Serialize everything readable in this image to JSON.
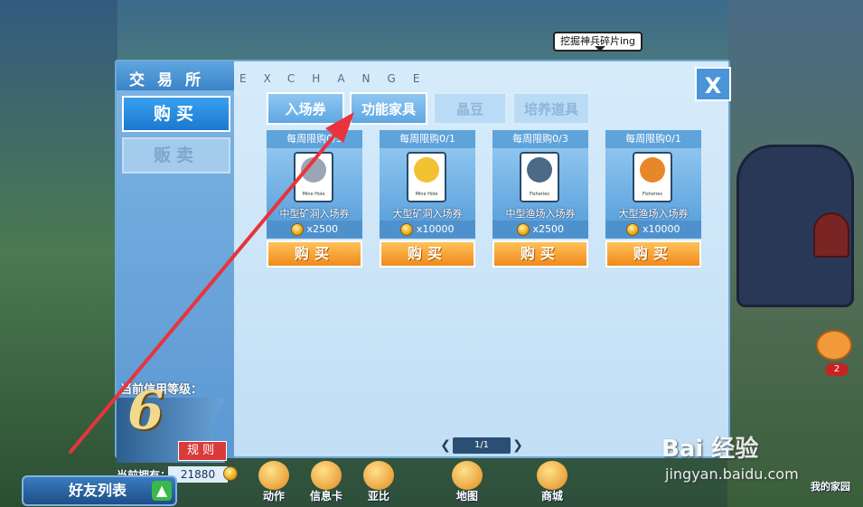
{
  "tooltip": "挖掘神兵碎片ing",
  "panel": {
    "title": "交易所",
    "subtitle": "EXCHANGE",
    "close_label": "X"
  },
  "sidebar": {
    "buy_label": "购买",
    "sell_label": "贩卖",
    "credit_label": "当前信用等级：",
    "credit_level": "6",
    "rule_label": "规则",
    "owned_label": "当前拥有：",
    "owned_value": "21880"
  },
  "tabs": [
    {
      "label": "入场券",
      "active": true
    },
    {
      "label": "功能家具",
      "active": true
    },
    {
      "label": "晶豆",
      "active": false
    },
    {
      "label": "培养道具",
      "active": false
    }
  ],
  "items": [
    {
      "limit": "每周限购0/3",
      "name": "中型矿洞入场券",
      "price": "x2500",
      "ticket_text": "Mine Hole",
      "buy_label": "购买",
      "art_color": "#9aa6b4"
    },
    {
      "limit": "每周限购0/1",
      "name": "大型矿洞入场券",
      "price": "x10000",
      "ticket_text": "Mine Hole",
      "buy_label": "购买",
      "art_color": "#f2c232"
    },
    {
      "limit": "每周限购0/3",
      "name": "中型渔场入场券",
      "price": "x2500",
      "ticket_text": "Fisheries",
      "buy_label": "购买",
      "art_color": "#4a6a86"
    },
    {
      "limit": "每周限购0/1",
      "name": "大型渔场入场券",
      "price": "x10000",
      "ticket_text": "Fisheries",
      "buy_label": "购买",
      "art_color": "#e8862a"
    }
  ],
  "pager": {
    "value": "1/1",
    "prev": "❮",
    "next": "❯"
  },
  "bottom": {
    "friends_label": "好友列表",
    "nav": [
      {
        "label": "动作"
      },
      {
        "label": "信息卡"
      },
      {
        "label": "亚比"
      },
      {
        "label": "地图"
      },
      {
        "label": "商城"
      }
    ],
    "home_label": "我的家园",
    "notif_count": "2"
  },
  "watermark": {
    "brand": "Bai 经验",
    "url": "jingyan.baidu.com"
  },
  "colors": {
    "accent": "#3b84c8",
    "buy_button": "#f08a1a",
    "annotation_arrow": "#e8343a"
  }
}
